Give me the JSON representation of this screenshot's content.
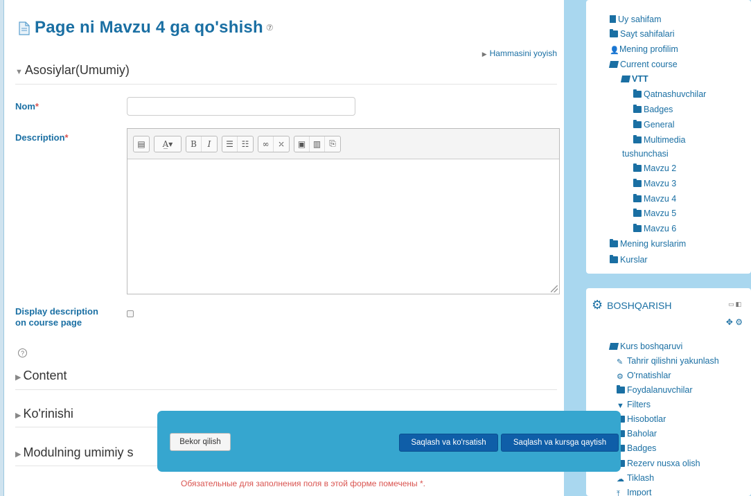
{
  "page": {
    "title": "Page ni Mavzu 4 ga qo'shish",
    "expand_all": "Hammasini yoyish"
  },
  "sections": {
    "general": "Asosiylar(Umumiy)",
    "content": "Content",
    "appearance": "Ko'rinishi",
    "common_module": "Modulning umimiy s"
  },
  "form": {
    "name_label": "Nom",
    "name_value": "",
    "description_label": "Description",
    "required_mark": "*",
    "display_description_label": "Display description on course page",
    "display_description_checked": false,
    "required_note": "Обязательные для заполнения поля в этой форме помечены *."
  },
  "editor": {
    "toolbar_groups": [
      [
        "toolbar-toggle-icon"
      ],
      [
        "font-size-icon"
      ],
      [
        "bold-icon",
        "italic-icon"
      ],
      [
        "bullet-list-icon",
        "numbered-list-icon"
      ],
      [
        "link-icon",
        "unlink-icon"
      ],
      [
        "image-icon",
        "media-icon",
        "files-icon"
      ]
    ],
    "content": ""
  },
  "navigation": {
    "items": [
      {
        "label": "Uy sahifam",
        "icon": "page-icon"
      },
      {
        "label": "Sayt sahifalari",
        "icon": "folder-icon"
      },
      {
        "label": "Mening profilim",
        "icon": "user-icon"
      },
      {
        "label": "Current course",
        "icon": "folder-open-icon"
      },
      {
        "label": "VTT",
        "icon": "folder-open-icon"
      },
      {
        "label": "Qatnashuvchilar",
        "icon": "folder-icon"
      },
      {
        "label": "Badges",
        "icon": "folder-icon"
      },
      {
        "label": "General",
        "icon": "folder-icon"
      },
      {
        "label": "Multimedia",
        "icon": "folder-icon"
      },
      {
        "label": "tushunchasi",
        "icon": ""
      },
      {
        "label": "Mavzu 2",
        "icon": "folder-icon"
      },
      {
        "label": "Mavzu 3",
        "icon": "folder-icon"
      },
      {
        "label": "Mavzu 4",
        "icon": "folder-icon"
      },
      {
        "label": "Mavzu 5",
        "icon": "folder-icon"
      },
      {
        "label": "Mavzu 6",
        "icon": "folder-icon"
      },
      {
        "label": "Mening kurslarim",
        "icon": "folder-icon"
      },
      {
        "label": "Kurslar",
        "icon": "folder-icon"
      }
    ]
  },
  "admin": {
    "title": "BOSHQARISH",
    "items": [
      {
        "label": "Kurs boshqaruvi",
        "icon": "folder-open-icon"
      },
      {
        "label": "Tahrir qilishni yakunlash",
        "icon": "pencil-icon"
      },
      {
        "label": "O'rnatishlar",
        "icon": "gear-icon"
      },
      {
        "label": "Foydalanuvchilar",
        "icon": "folder-icon"
      },
      {
        "label": "Filters",
        "icon": "filter-icon"
      },
      {
        "label": "Hisobotlar",
        "icon": "folder-icon"
      },
      {
        "label": "Baholar",
        "icon": "folder-icon"
      },
      {
        "label": "Badges",
        "icon": "folder-icon"
      },
      {
        "label": "Rezerv nusxa olish",
        "icon": "folder-icon"
      },
      {
        "label": "Tiklash",
        "icon": "upload-icon"
      },
      {
        "label": "Import",
        "icon": "import-icon"
      }
    ]
  },
  "actions": {
    "cancel": "Bekor qilish",
    "save_and_display": "Saqlash va ko'rsatish",
    "save_and_return": "Saqlash va kursga qaytish"
  },
  "colors": {
    "link": "#1a6fa3",
    "sidebar_bg": "#a9d7ef",
    "action_bar": "#36a6cf",
    "primary_button": "#0f5ea8",
    "required": "#d9534f"
  }
}
